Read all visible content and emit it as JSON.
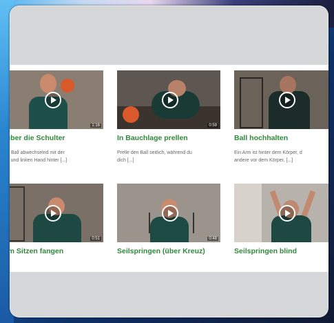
{
  "videos": [
    {
      "title": "ll über die Schulter",
      "desc": "f der Ball abwechselnd mit der\nhten und linken Hand hinter [...]",
      "duration": "1:16"
    },
    {
      "title": "In Bauchlage prellen",
      "desc": "Prelle den Ball seitlich, während du\ndich [...]",
      "duration": "0:59"
    },
    {
      "title": "Ball hochhalten",
      "desc": "Ein Arm ist hinter dem Körper, d\nandere vor dem Körper, [...]",
      "duration": ""
    },
    {
      "title": "ll im Sitzen fangen",
      "desc": "",
      "duration": "0:51"
    },
    {
      "title": "Seilspringen (über Kreuz)",
      "desc": "",
      "duration": "0:48"
    },
    {
      "title": "Seilspringen blind",
      "desc": "",
      "duration": ""
    }
  ],
  "colors": {
    "title_green": "#2f8a3a",
    "frame_gray": "#d6d7d8"
  }
}
